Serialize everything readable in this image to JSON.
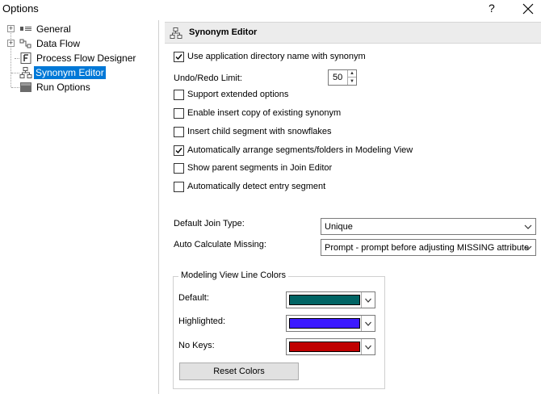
{
  "window": {
    "title": "Options",
    "help_label": "?"
  },
  "tree": {
    "items": [
      {
        "label": "General"
      },
      {
        "label": "Data Flow"
      },
      {
        "label": "Process Flow Designer"
      },
      {
        "label": "Synonym Editor"
      },
      {
        "label": "Run Options"
      }
    ],
    "selected": "Synonym Editor"
  },
  "panel": {
    "title": "Synonym Editor"
  },
  "options": {
    "use_app_dir": {
      "label": "Use application directory name with synonym",
      "checked": true
    },
    "undo_redo_label": "Undo/Redo Limit:",
    "undo_redo_value": "50",
    "support_extended": {
      "label": "Support extended options",
      "checked": false
    },
    "insert_copy": {
      "label": "Enable insert copy of existing synonym",
      "checked": false
    },
    "insert_child": {
      "label": "Insert child segment with snowflakes",
      "checked": false
    },
    "auto_arrange": {
      "label": "Automatically arrange segments/folders in Modeling View",
      "checked": true
    },
    "show_parent": {
      "label": "Show parent segments in Join Editor",
      "checked": false
    },
    "auto_detect": {
      "label": "Automatically detect entry segment",
      "checked": false
    }
  },
  "join": {
    "default_label": "Default Join Type:",
    "default_value": "Unique",
    "missing_label": "Auto Calculate Missing:",
    "missing_value": "Prompt - prompt before adjusting MISSING attribute"
  },
  "colors": {
    "group_title": "Modeling View Line Colors",
    "default_label": "Default:",
    "default_color": "#006464",
    "highlighted_label": "Highlighted:",
    "highlighted_color": "#3c1aff",
    "nokeys_label": "No Keys:",
    "nokeys_color": "#c00000",
    "reset_label": "Reset Colors"
  }
}
